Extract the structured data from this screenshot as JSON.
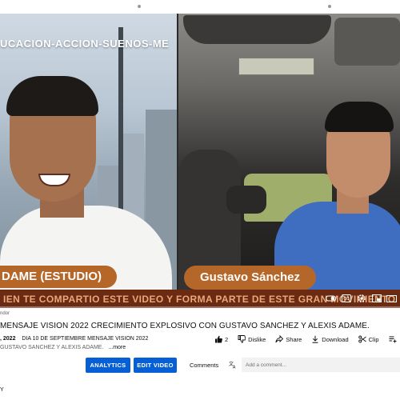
{
  "video": {
    "banner_text": "UCACION-ACCION-SUENOS-ME",
    "left_name_tag": "DAME (ESTUDIO)",
    "right_name_tag": "Gustavo Sánchez",
    "ticker_text": "IEN TE COMPARTIO ESTE VIDEO Y FORMA PARTE DE ESTE GRAN MOVIMIENTO",
    "progress_fraction": 0.0
  },
  "controls": {
    "icons": [
      "autoplay-toggle-icon",
      "captions-icon",
      "settings-icon",
      "miniplayer-icon",
      "theater-icon"
    ]
  },
  "info": {
    "owner_label": "ndor",
    "title": "MENSAJE VISION 2022 CRECIMIENTO EXPLOSIVO CON GUSTAVO SANCHEZ Y ALEXIS ADAME.",
    "date": ", 2022",
    "description_line1": "DIA 10 DE SEPTIEMBRE MENSAJE VISION 2022",
    "description_line2": "GUSTAVO SANCHEZ Y ALEXIS ADAME.",
    "more_label": "...more"
  },
  "actions": {
    "like_count": "2",
    "dislike_label": "Dislike",
    "share_label": "Share",
    "download_label": "Download",
    "clip_label": "Clip"
  },
  "buttons": {
    "analytics_label": "ANALYTICS",
    "edit_label": "EDIT VIDEO"
  },
  "comments": {
    "label": "Comments",
    "placeholder": "Add a comment..."
  },
  "footer": {
    "text": "Y"
  },
  "colors": {
    "accent_blue": "#065fd4",
    "name_tag": "#b5672a",
    "ticker_bg": "#6b2a12",
    "progress_red": "#ff0000"
  }
}
